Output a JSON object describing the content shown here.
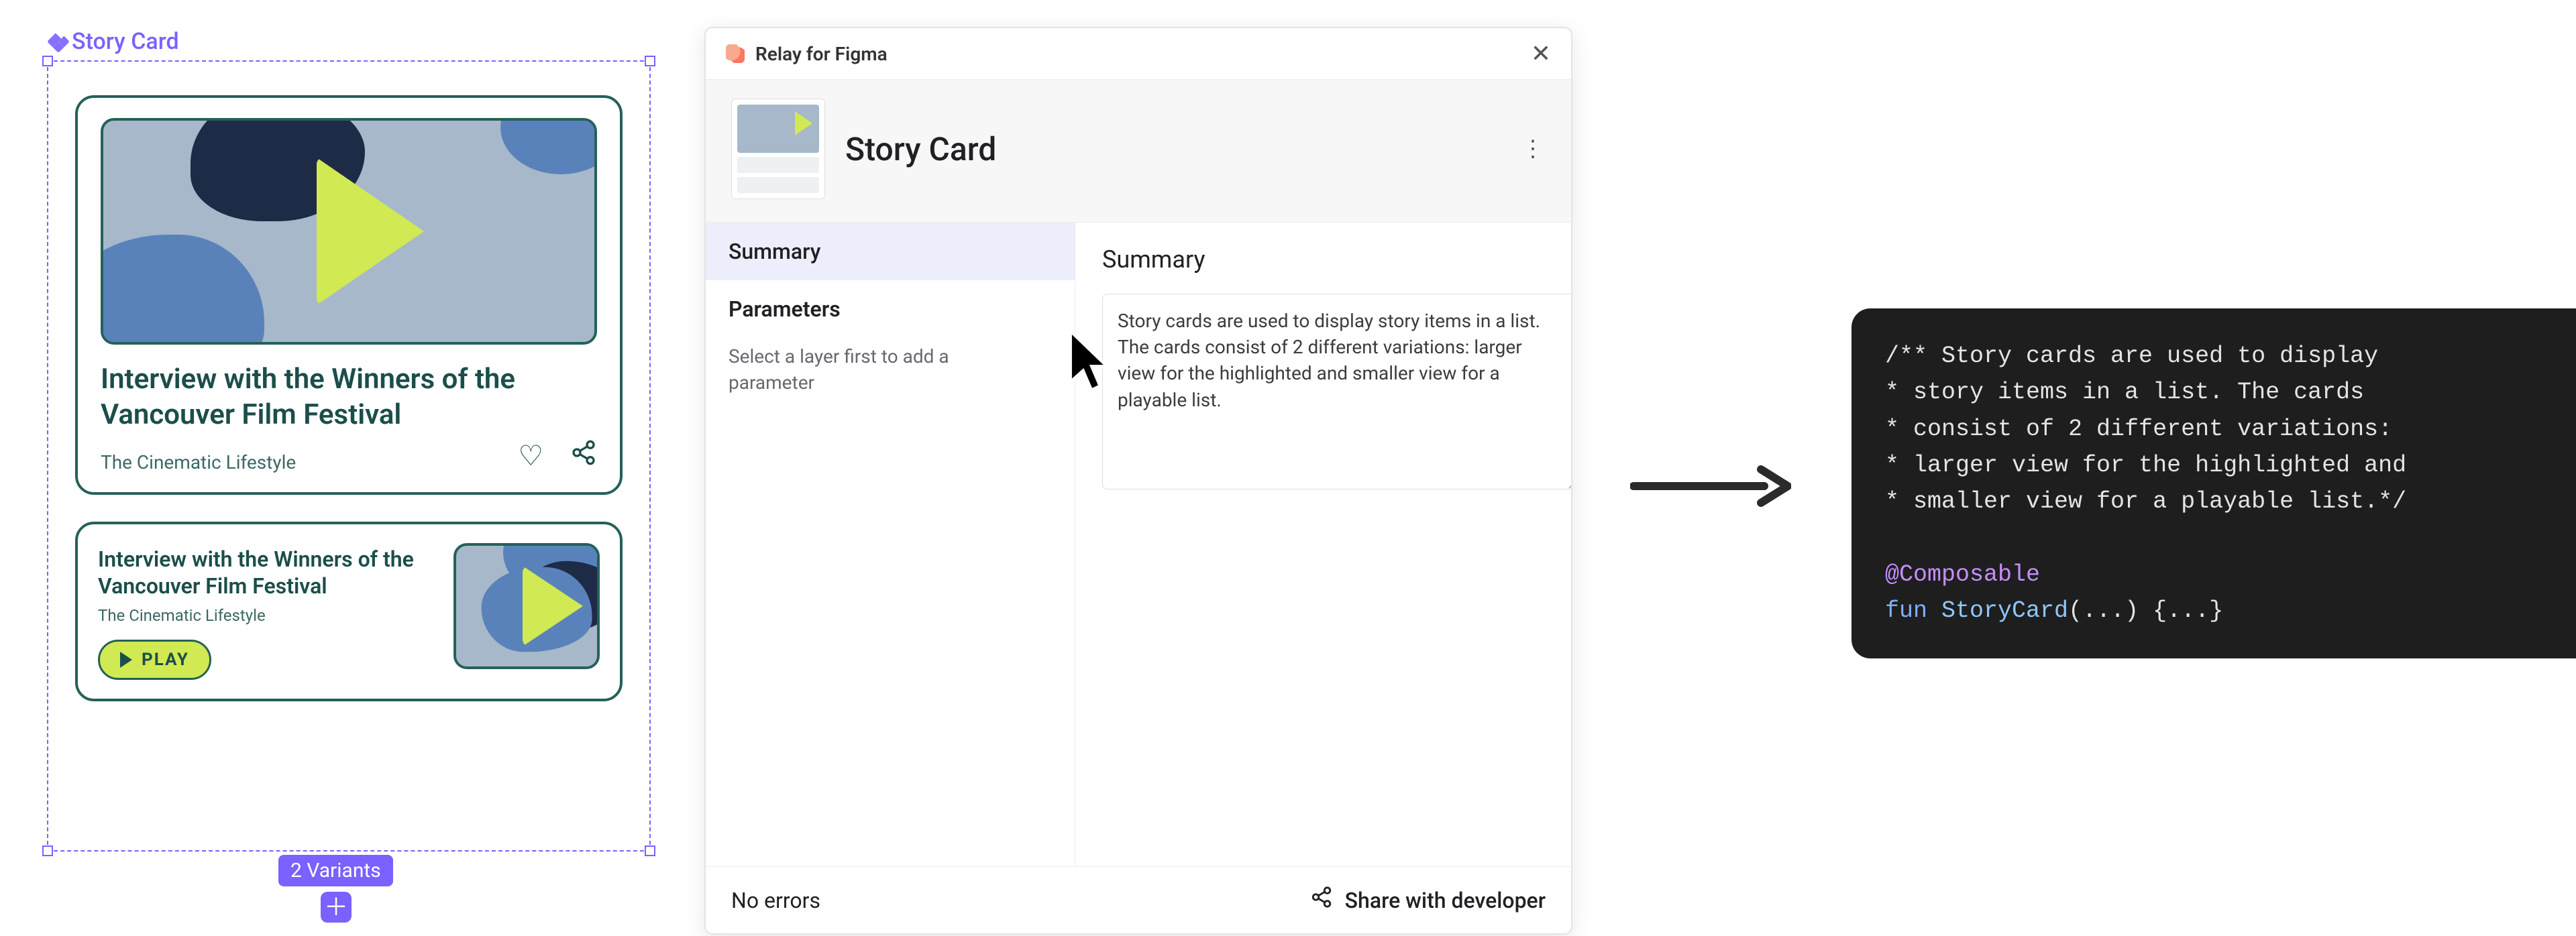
{
  "figma": {
    "frame_label": "Story Card",
    "variants_badge": "2 Variants",
    "card_large": {
      "title": "Interview with the Winners of the Vancouver Film Festival",
      "subtitle": "The Cinematic Lifestyle",
      "heart": "♡",
      "share": "↗"
    },
    "card_small": {
      "title": "Interview with the Winners of the Vancouver Film Festival",
      "subtitle": "The Cinematic Lifestyle",
      "play_label": "PLAY"
    }
  },
  "relay": {
    "app_title": "Relay for Figma",
    "component_name": "Story Card",
    "tabs": {
      "summary": "Summary",
      "parameters": "Parameters"
    },
    "parameters_hint": "Select a layer first to add a parameter",
    "summary_heading": "Summary",
    "summary_text": "Story cards are used to display story items in a list. The cards consist of 2 different variations: larger view for the highlighted and smaller view for a playable list.",
    "footer_status": "No errors",
    "footer_share": "Share with developer",
    "close_glyph": "✕",
    "more_glyph": "⋮"
  },
  "code": {
    "line1": "/** Story cards are used to display",
    "line2": "* story items in a list. The cards",
    "line3": "* consist of 2 different variations:",
    "line4": "* larger view for the highlighted and",
    "line5": "* smaller view for a playable list.*/",
    "blank": "",
    "annotation": "@Composable",
    "keyword_fun": "fun",
    "fn_name": "StoryCard",
    "rest": "(...) {...}"
  }
}
